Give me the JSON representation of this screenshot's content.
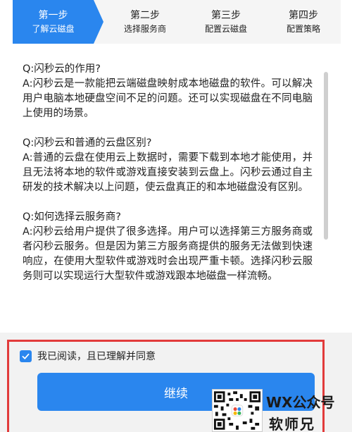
{
  "steps": [
    {
      "title": "第一步",
      "subtitle": "了解云磁盘",
      "active": true
    },
    {
      "title": "第二步",
      "subtitle": "选择服务商",
      "active": false
    },
    {
      "title": "第三步",
      "subtitle": "配置云磁盘",
      "active": false
    },
    {
      "title": "第四步",
      "subtitle": "配置策略",
      "active": false
    }
  ],
  "faq": [
    {
      "q": "Q:闪秒云的作用?",
      "a": "A:闪秒云是一款能把云端磁盘映射成本地磁盘的软件。可以解决用户电脑本地硬盘空间不足的问题。还可以实现磁盘在不同电脑上使用的场景。"
    },
    {
      "q": "Q:闪秒云和普通的云盘区别?",
      "a": "A:普通的云盘在使用云上数据时，需要下载到本地才能使用，并且无法将本地的软件或游戏直接安装到云盘上。闪秒云通过自主研发的技术解决以上问题，使云盘真正的和本地磁盘没有区别。"
    },
    {
      "q": "Q:如何选择云服务商?",
      "a": "A:闪秒云给用户提供了很多选择。用户可以选择第三方服务商或者闪秒云服务。但是因为第三方服务商提供的服务无法做到快速响应，在使用大型软件或游戏时会出现严重卡顿。选择闪秒云服务则可以实现运行大型软件或游戏跟本地磁盘一样流畅。"
    }
  ],
  "agree": {
    "label": "我已阅读，且已理解并同意",
    "checked": true
  },
  "continue_label": "继续",
  "watermark": {
    "line1": "WX公众号",
    "line2": "软师兄"
  },
  "colors": {
    "accent": "#2a86ee",
    "highlight_frame": "#e23b3b"
  }
}
